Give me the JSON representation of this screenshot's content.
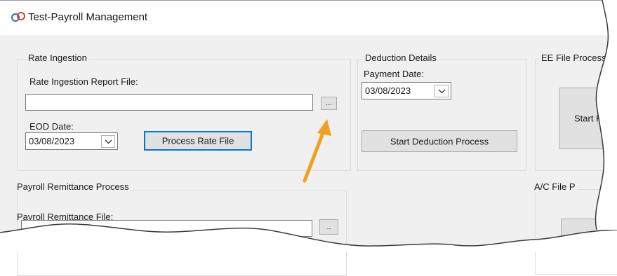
{
  "window": {
    "title": "Test-Payroll Management",
    "icon": "link-icon"
  },
  "rate_ingestion": {
    "group_label": "Rate Ingestion",
    "report_file_label": "Rate Ingestion Report File:",
    "report_file_value": "",
    "browse_label": "...",
    "eod_label": "EOD Date:",
    "eod_date": "03/08/2023",
    "process_button": "Process Rate File"
  },
  "deduction_details": {
    "group_label": "Deduction Details",
    "payment_date_label": "Payment Date:",
    "payment_date": "03/08/2023",
    "start_button": "Start Deduction Process"
  },
  "ee_file_processing": {
    "group_label": "EE File Processi",
    "start_button": "Start File"
  },
  "payroll_remittance": {
    "group_label": "Payroll Remittance Process",
    "file_label": "Payroll Remittance File:",
    "file_value": "",
    "browse_label": ".."
  },
  "ac_file": {
    "group_label": "A/C File P"
  },
  "colors": {
    "accent": "#0078d7",
    "annotation_arrow": "#f0a020",
    "control_bg": "#f0f0f0"
  }
}
